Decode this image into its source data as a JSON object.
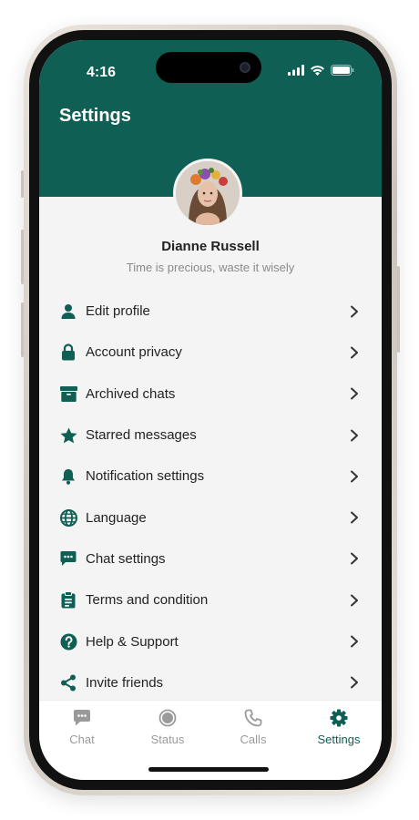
{
  "status_bar": {
    "time": "4:16"
  },
  "header": {
    "title": "Settings"
  },
  "profile": {
    "name": "Dianne Russell",
    "status": "Time is precious, waste it wisely"
  },
  "menu": [
    {
      "label": "Edit profile",
      "icon": "person-icon"
    },
    {
      "label": "Account privacy",
      "icon": "lock-icon"
    },
    {
      "label": "Archived chats",
      "icon": "archive-icon"
    },
    {
      "label": "Starred messages",
      "icon": "star-icon"
    },
    {
      "label": "Notification settings",
      "icon": "bell-icon"
    },
    {
      "label": "Language",
      "icon": "globe-icon"
    },
    {
      "label": "Chat settings",
      "icon": "chat-bubble-icon"
    },
    {
      "label": "Terms and condition",
      "icon": "clipboard-icon"
    },
    {
      "label": "Help & Support",
      "icon": "help-icon"
    },
    {
      "label": "Invite friends",
      "icon": "share-icon"
    }
  ],
  "tabs": [
    {
      "label": "Chat",
      "icon": "chat-icon",
      "active": false
    },
    {
      "label": "Status",
      "icon": "status-icon",
      "active": false
    },
    {
      "label": "Calls",
      "icon": "phone-icon",
      "active": false
    },
    {
      "label": "Settings",
      "icon": "gear-icon",
      "active": true
    }
  ],
  "colors": {
    "brand": "#0f5f54",
    "inactive": "#9a9a9a",
    "background": "#f4f4f4"
  }
}
